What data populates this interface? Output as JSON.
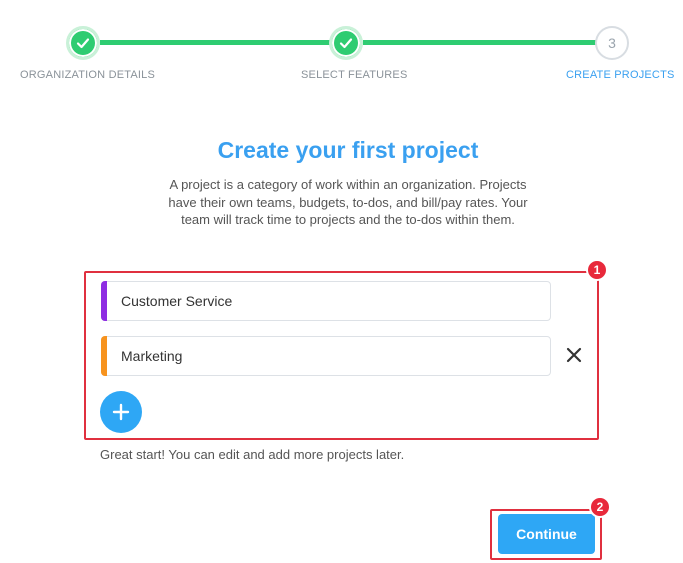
{
  "stepper": {
    "steps": [
      {
        "label": "ORGANIZATION DETAILS",
        "state": "complete",
        "icon": "check-icon"
      },
      {
        "label": "SELECT FEATURES",
        "state": "complete",
        "icon": "check-icon"
      },
      {
        "label": "CREATE PROJECTS",
        "state": "current",
        "number": "3"
      }
    ],
    "complete_color": "#2ecc71",
    "active_color": "#3aa0f0"
  },
  "main": {
    "title": "Create your first project",
    "description": "A project is a category of work within an organization. Projects have their own teams, budgets, to-dos, and bill/pay rates. Your team will track time to projects and the to-dos within them."
  },
  "projects": {
    "items": [
      {
        "name": "Customer Service",
        "color": "#8e2de2"
      },
      {
        "name": "Marketing",
        "color": "#f7931e"
      }
    ],
    "remove_icon": "close-icon",
    "add_icon": "plus-icon",
    "helper_text": "Great start! You can edit and add more projects later."
  },
  "annotations": {
    "badge_1": "1",
    "badge_2": "2",
    "highlight_color": "#e0303f"
  },
  "footer": {
    "continue_label": "Continue",
    "button_color": "#2ea7f5"
  }
}
